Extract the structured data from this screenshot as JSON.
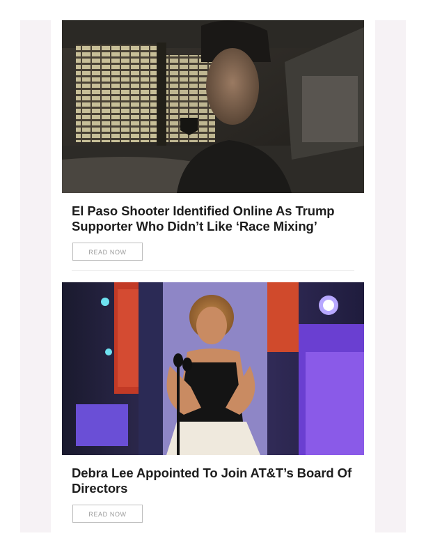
{
  "articles": [
    {
      "headline": "El Paso Shooter Identified Online As Trump Supporter Who Didn’t Like ‘Race Mixing’",
      "button_label": "READ NOW"
    },
    {
      "headline": "Debra Lee Appointed To Join AT&T’s Board Of Directors",
      "button_label": "READ NOW"
    }
  ]
}
